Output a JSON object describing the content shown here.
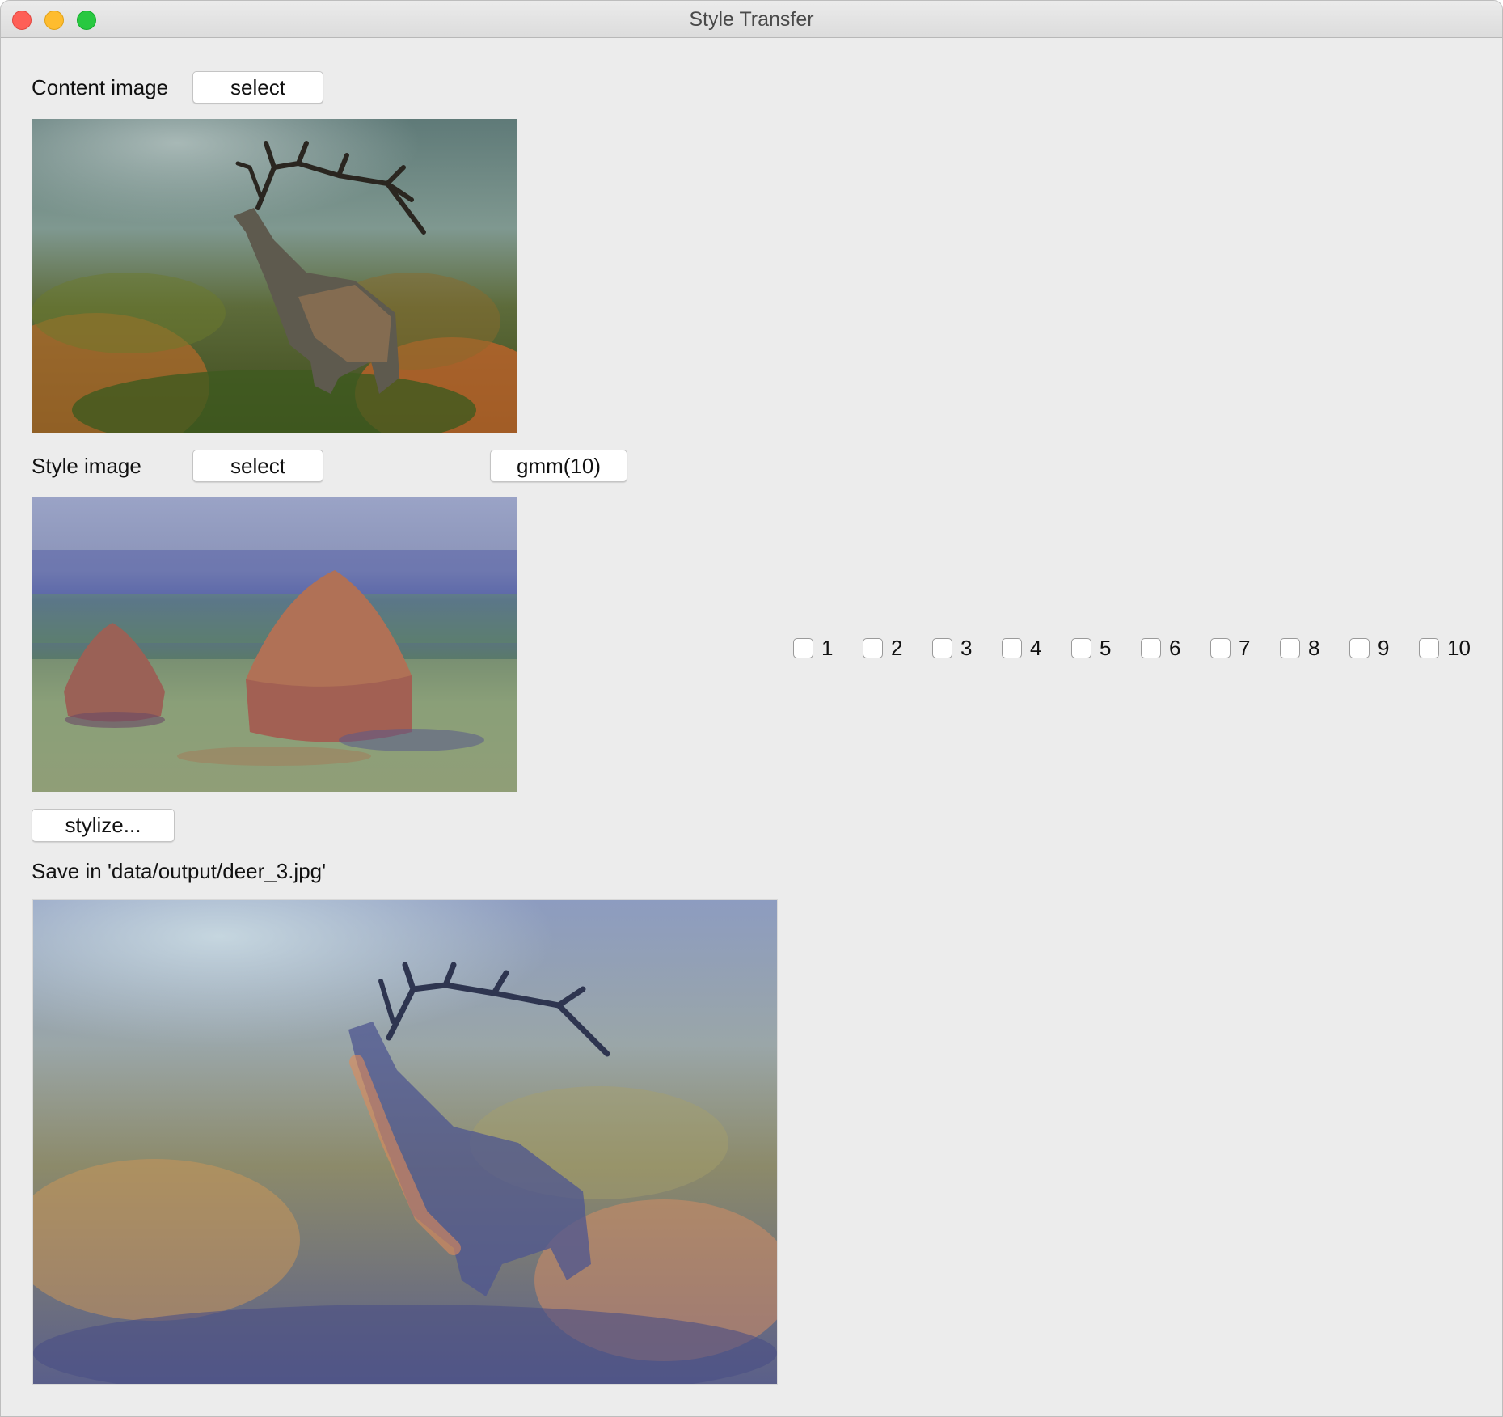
{
  "window": {
    "title": "Style Transfer"
  },
  "content_section": {
    "label": "Content image",
    "select_label": "select",
    "image_alt": "red deer stag bellowing among ferns"
  },
  "style_section": {
    "label": "Style image",
    "select_label": "select",
    "model_button_label": "gmm(10)",
    "image_alt": "impressionist painting of haystacks"
  },
  "stylize_button_label": "stylize...",
  "save_status": "Save in 'data/output/deer_3.jpg'",
  "output": {
    "image_alt": "stylized deer image"
  },
  "checkboxes": [
    {
      "label": "1",
      "checked": false
    },
    {
      "label": "2",
      "checked": false
    },
    {
      "label": "3",
      "checked": false
    },
    {
      "label": "4",
      "checked": false
    },
    {
      "label": "5",
      "checked": false
    },
    {
      "label": "6",
      "checked": false
    },
    {
      "label": "7",
      "checked": false
    },
    {
      "label": "8",
      "checked": false
    },
    {
      "label": "9",
      "checked": false
    },
    {
      "label": "10",
      "checked": false
    }
  ],
  "colors": {
    "window_bg": "#ececec",
    "close": "#fe5f57",
    "minimize": "#febc2e",
    "maximize": "#28c840"
  }
}
